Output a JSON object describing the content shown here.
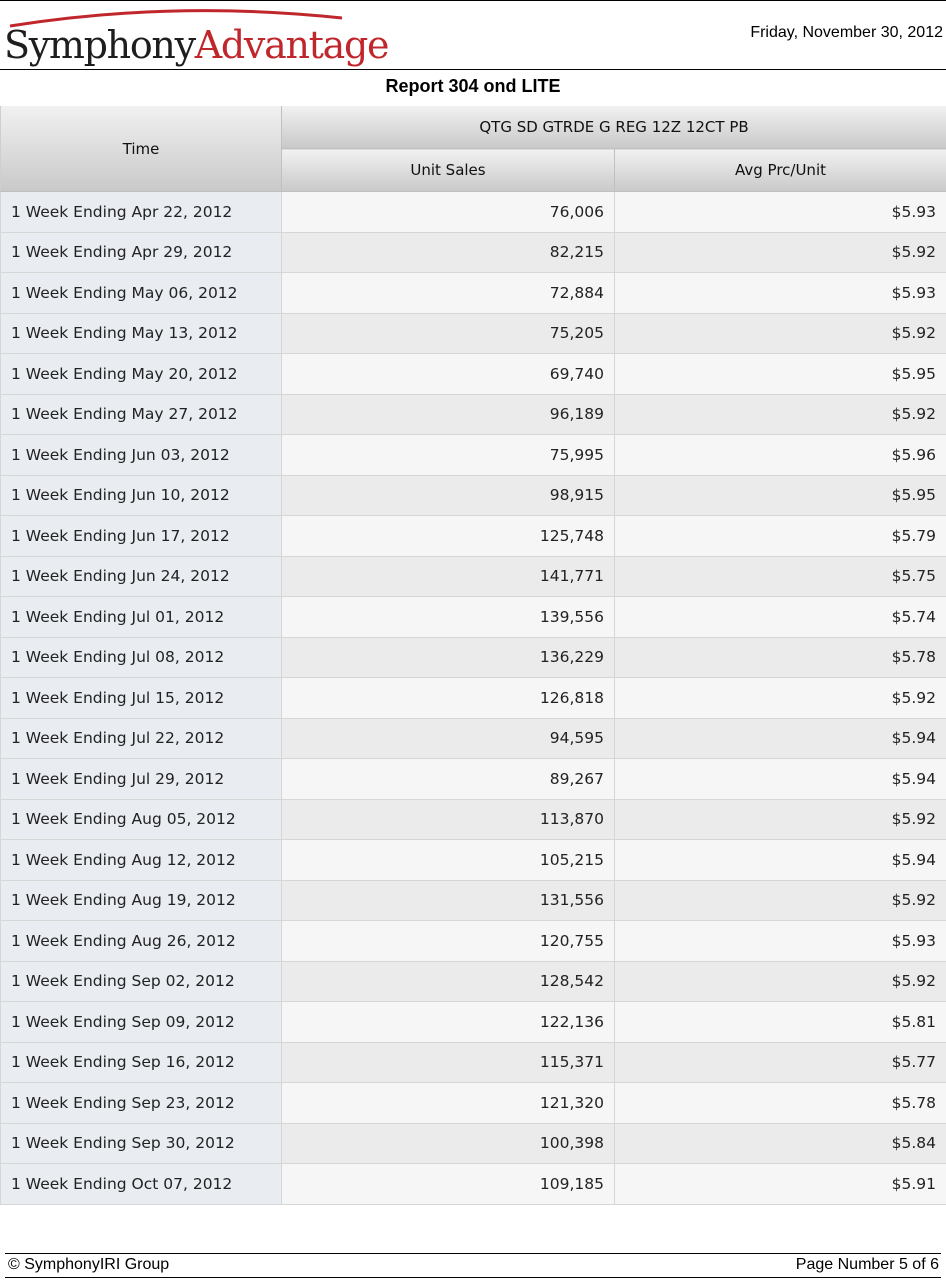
{
  "header": {
    "logo_part1": "Symphony",
    "logo_part2": "Advantage",
    "date": "Friday, November 30, 2012"
  },
  "report": {
    "title": "Report 304 ond LITE"
  },
  "table": {
    "time_header": "Time",
    "product_header": "QTG SD GTRDE G REG 12Z 12CT PB",
    "columns": [
      "Unit Sales",
      "Avg Prc/Unit"
    ],
    "rows": [
      {
        "time": "1 Week Ending Apr 22, 2012",
        "units": "76,006",
        "price": "$5.93"
      },
      {
        "time": "1 Week Ending Apr 29, 2012",
        "units": "82,215",
        "price": "$5.92"
      },
      {
        "time": "1 Week Ending May 06, 2012",
        "units": "72,884",
        "price": "$5.93"
      },
      {
        "time": "1 Week Ending May 13, 2012",
        "units": "75,205",
        "price": "$5.92"
      },
      {
        "time": "1 Week Ending May 20, 2012",
        "units": "69,740",
        "price": "$5.95"
      },
      {
        "time": "1 Week Ending May 27, 2012",
        "units": "96,189",
        "price": "$5.92"
      },
      {
        "time": "1 Week Ending Jun 03, 2012",
        "units": "75,995",
        "price": "$5.96"
      },
      {
        "time": "1 Week Ending Jun 10, 2012",
        "units": "98,915",
        "price": "$5.95"
      },
      {
        "time": "1 Week Ending Jun 17, 2012",
        "units": "125,748",
        "price": "$5.79"
      },
      {
        "time": "1 Week Ending Jun 24, 2012",
        "units": "141,771",
        "price": "$5.75"
      },
      {
        "time": "1 Week Ending Jul 01, 2012",
        "units": "139,556",
        "price": "$5.74"
      },
      {
        "time": "1 Week Ending Jul 08, 2012",
        "units": "136,229",
        "price": "$5.78"
      },
      {
        "time": "1 Week Ending Jul 15, 2012",
        "units": "126,818",
        "price": "$5.92"
      },
      {
        "time": "1 Week Ending Jul 22, 2012",
        "units": "94,595",
        "price": "$5.94"
      },
      {
        "time": "1 Week Ending Jul 29, 2012",
        "units": "89,267",
        "price": "$5.94"
      },
      {
        "time": "1 Week Ending Aug 05, 2012",
        "units": "113,870",
        "price": "$5.92"
      },
      {
        "time": "1 Week Ending Aug 12, 2012",
        "units": "105,215",
        "price": "$5.94"
      },
      {
        "time": "1 Week Ending Aug 19, 2012",
        "units": "131,556",
        "price": "$5.92"
      },
      {
        "time": "1 Week Ending Aug 26, 2012",
        "units": "120,755",
        "price": "$5.93"
      },
      {
        "time": "1 Week Ending Sep 02, 2012",
        "units": "128,542",
        "price": "$5.92"
      },
      {
        "time": "1 Week Ending Sep 09, 2012",
        "units": "122,136",
        "price": "$5.81"
      },
      {
        "time": "1 Week Ending Sep 16, 2012",
        "units": "115,371",
        "price": "$5.77"
      },
      {
        "time": "1 Week Ending Sep 23, 2012",
        "units": "121,320",
        "price": "$5.78"
      },
      {
        "time": "1 Week Ending Sep 30, 2012",
        "units": "100,398",
        "price": "$5.84"
      },
      {
        "time": "1 Week Ending Oct 07, 2012",
        "units": "109,185",
        "price": "$5.91"
      }
    ]
  },
  "footer": {
    "copyright": "© SymphonyIRI Group",
    "page": "Page Number 5 of 6"
  },
  "colors": {
    "brand_red": "#c0272d",
    "brand_dark": "#1e1e1e"
  }
}
